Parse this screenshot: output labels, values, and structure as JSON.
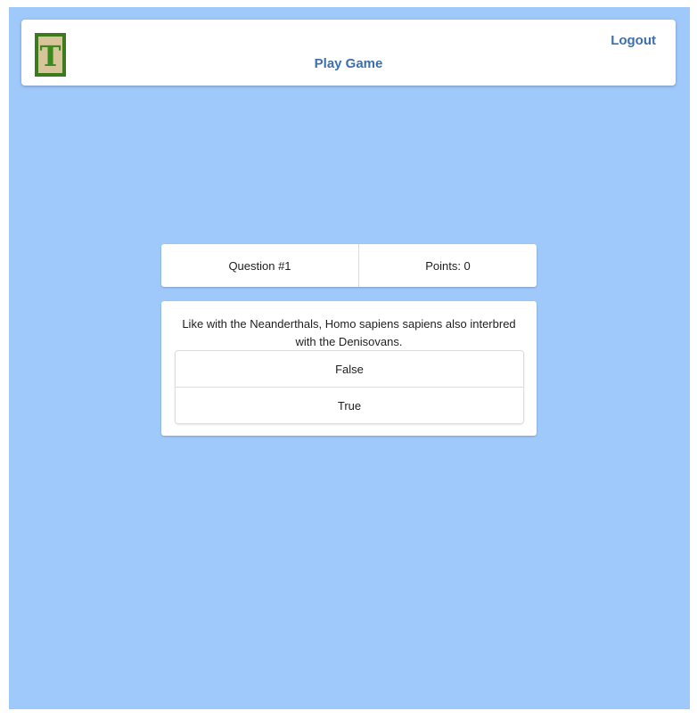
{
  "nav": {
    "logo_letter": "T",
    "play_label": "Play Game",
    "logout_label": "Logout"
  },
  "stats": {
    "question_label": "Question #1",
    "points_label": "Points: 0"
  },
  "question": {
    "text": "Like with the Neanderthals, Homo sapiens sapiens also interbred with the Denisovans.",
    "answers": [
      {
        "label": "False"
      },
      {
        "label": "True"
      }
    ]
  },
  "colors": {
    "page_background": "#9fc8fb",
    "link": "#3c6fae",
    "logo_green": "#3a8a1e",
    "logo_tile": "#d9c39a"
  }
}
